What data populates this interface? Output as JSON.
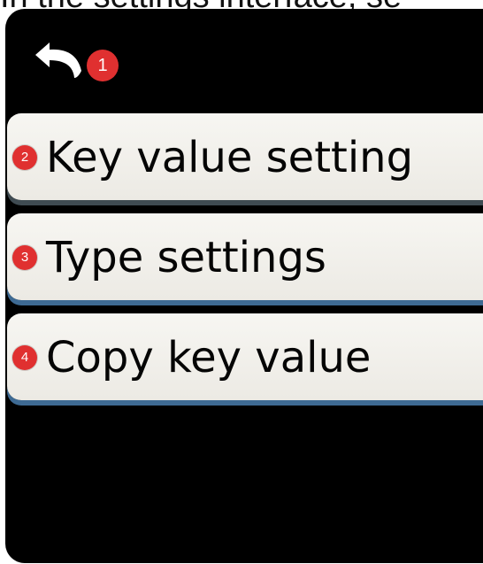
{
  "caption": "In the settings interface, se",
  "back": {
    "icon": "back-arrow-icon",
    "badge": "1"
  },
  "menu": {
    "items": [
      {
        "badge": "2",
        "label": "Key value setting"
      },
      {
        "badge": "3",
        "label": "Type settings"
      },
      {
        "badge": "4",
        "label": "Copy key value"
      }
    ]
  },
  "colors": {
    "screen_background": "#000000",
    "item_background": "#f2f0eb",
    "badge_red": "#e03030",
    "item_edge_dark": "#3f4b52",
    "item_edge_blue": "#3e6a93"
  }
}
